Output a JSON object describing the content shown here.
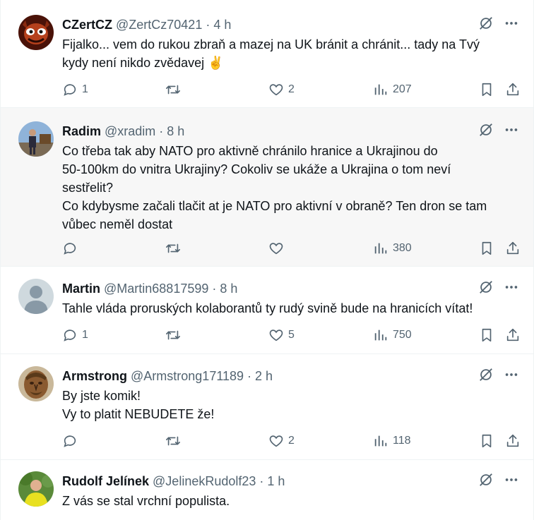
{
  "tweets": [
    {
      "name": "CZertCZ",
      "handle": "@ZertCz70421",
      "sep": "·",
      "time": "4 h",
      "text": "Fijalko... vem do rukou zbraň a mazej na UK bránit a chránit... tady na Tvý\nkydy není nikdo zvědavej ✌️",
      "replies": "1",
      "retweets": "",
      "likes": "2",
      "views": "207",
      "avatar_icon": "devil-mask-avatar"
    },
    {
      "name": "Radim",
      "handle": "@xradim",
      "sep": "·",
      "time": "8 h",
      "text": "Co třeba tak aby NATO pro aktivně chránilo hranice a Ukrajinou do\n50-100km do vnitra Ukrajiny? Cokoliv se ukáže a Ukrajina o tom neví\nsestřelit?\nCo kdybysme začali tlačit at je NATO pro aktivní v obraně? Ten dron se tam\nvůbec neměl dostat",
      "replies": "",
      "retweets": "",
      "likes": "",
      "views": "380",
      "avatar_icon": "photo-avatar"
    },
    {
      "name": "Martin",
      "handle": "@Martin68817599",
      "sep": "·",
      "time": "8 h",
      "text": "Tahle vláda proruských kolaborantů ty rudý svině bude na hranicích vítat!",
      "replies": "1",
      "retweets": "",
      "likes": "5",
      "views": "750",
      "avatar_icon": "default-person-avatar"
    },
    {
      "name": "Armstrong",
      "handle": "@Armstrong171189",
      "sep": "·",
      "time": "2 h",
      "text": "By jste komik!\nVy to platit NEBUDETE že!",
      "replies": "",
      "retweets": "",
      "likes": "2",
      "views": "118",
      "avatar_icon": "carved-face-avatar"
    },
    {
      "name": "Rudolf Jelínek",
      "handle": "@JelinekRudolf23",
      "sep": "·",
      "time": "1 h",
      "text": "Z vás se stal vrchní populista.",
      "replies": "",
      "retweets": "",
      "likes": "",
      "views": "",
      "avatar_icon": "photo-avatar"
    }
  ],
  "colors": {
    "text": "#0f1419",
    "muted": "#536471",
    "hover_bg": "#f7f7f7",
    "divider": "#eff3f4"
  }
}
